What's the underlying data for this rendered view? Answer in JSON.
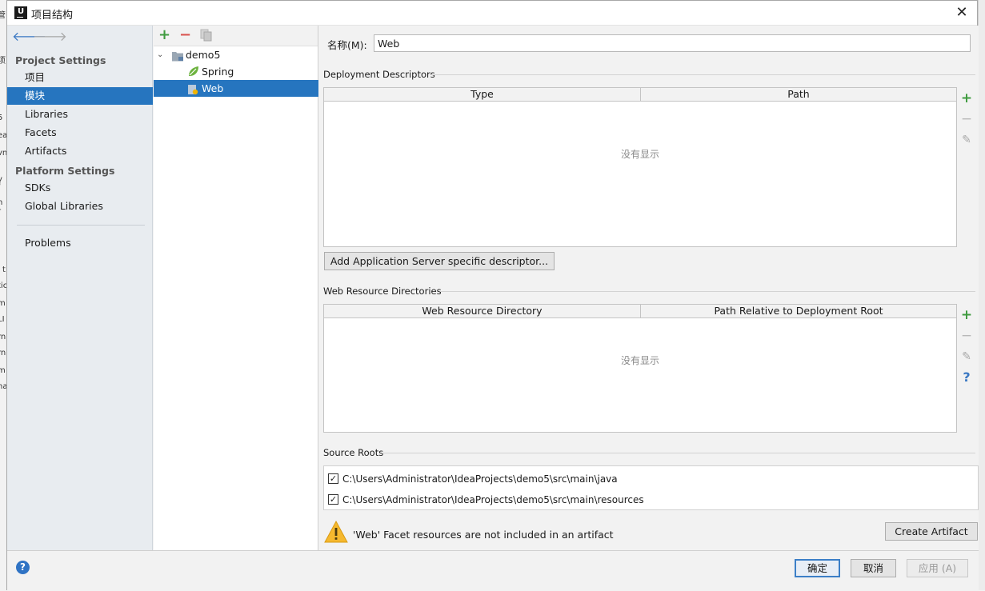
{
  "left_strip_fragments": [
    "管",
    "项",
    "5",
    "ea",
    "vn",
    "l v",
    "f",
    "n r",
    "l t",
    "tic",
    "m",
    "LI",
    "rn",
    "rn",
    "m",
    "ha"
  ],
  "dialog": {
    "title": "项目结构",
    "close_icon": "close-icon"
  },
  "sidebar": {
    "back_icon": "arrow-left-icon",
    "forward_icon": "arrow-right-icon",
    "project_settings_header": "Project Settings",
    "project_items": [
      {
        "label": "项目"
      },
      {
        "label": "模块"
      },
      {
        "label": "Libraries"
      },
      {
        "label": "Facets"
      },
      {
        "label": "Artifacts"
      }
    ],
    "platform_settings_header": "Platform Settings",
    "platform_items": [
      {
        "label": "SDKs"
      },
      {
        "label": "Global Libraries"
      }
    ],
    "problems": "Problems"
  },
  "tree": {
    "add_icon": "plus-icon",
    "remove_icon": "minus-icon",
    "copy_icon": "copy-icon",
    "root": "demo5",
    "children": [
      {
        "label": "Spring"
      },
      {
        "label": "Web"
      }
    ]
  },
  "content": {
    "name_label": "名称(M):",
    "name_value": "Web",
    "deployment_descriptors": {
      "title": "Deployment Descriptors",
      "columns": [
        "Type",
        "Path"
      ],
      "empty_text": "没有显示",
      "add_button": "Add Application Server specific descriptor..."
    },
    "web_resource_directories": {
      "title": "Web Resource Directories",
      "columns": [
        "Web Resource Directory",
        "Path Relative to Deployment Root"
      ],
      "empty_text": "没有显示"
    },
    "source_roots": {
      "title": "Source Roots",
      "items": [
        {
          "path": "C:\\Users\\Administrator\\IdeaProjects\\demo5\\src\\main\\java",
          "checked": true
        },
        {
          "path": "C:\\Users\\Administrator\\IdeaProjects\\demo5\\src\\main\\resources",
          "checked": true
        }
      ]
    },
    "warning_text": "'Web' Facet resources are not included in an artifact",
    "create_artifact_button": "Create Artifact"
  },
  "footer": {
    "ok": "确定",
    "cancel": "取消",
    "apply": "应用 (A)"
  },
  "colors": {
    "selection": "#2675bf",
    "add_green": "#3f9b3f",
    "remove_red": "#d9534f",
    "warning_yellow": "#f5b82e"
  }
}
